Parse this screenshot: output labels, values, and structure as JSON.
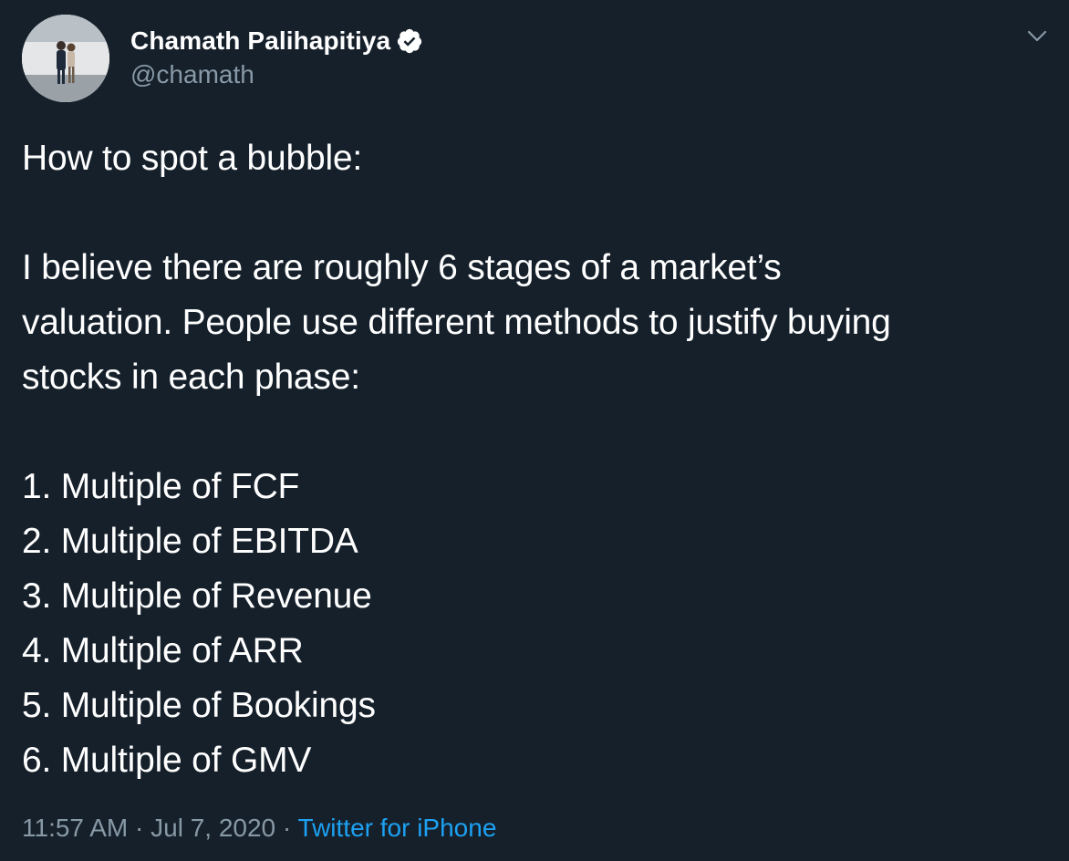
{
  "author": {
    "display_name": "Chamath Palihapitiya",
    "handle": "@chamath",
    "verified": true
  },
  "tweet": {
    "intro": "How to spot a bubble:",
    "paragraph": [
      "I believe there are roughly 6 stages of a market’s",
      "valuation. People use different methods to justify buying",
      "stocks in each phase:"
    ],
    "list": [
      "1. Multiple of FCF",
      "2. Multiple of EBITDA",
      "3. Multiple of Revenue",
      "4. Multiple of ARR",
      "5. Multiple of Bookings",
      "6. Multiple of GMV"
    ]
  },
  "meta": {
    "time": "11:57 AM",
    "separator": " · ",
    "date": "Jul 7, 2020",
    "source": "Twitter for iPhone"
  },
  "icons": {
    "verified": "verified-badge-icon",
    "menu": "chevron-down-icon"
  },
  "colors": {
    "background": "#15202b",
    "secondary_text": "#8899a6",
    "link": "#1da1f2",
    "text": "#ffffff"
  }
}
